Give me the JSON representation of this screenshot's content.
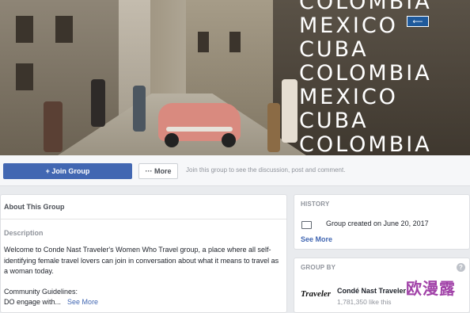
{
  "cover": {
    "overlay_words": [
      "COLOMBIA",
      "MEXICO",
      "CUBA",
      "COLOMBIA",
      "MEXICO",
      "CUBA",
      "COLOMBIA"
    ]
  },
  "actions": {
    "join_label": "+ Join Group",
    "more_label": "··· More",
    "join_note": "Join this group to see the discussion, post and comment."
  },
  "about": {
    "title": "About This Group",
    "description_heading": "Description",
    "description": "Welcome to Conde Nast Traveler's Women Who Travel group, a place where all self-identifying female travel lovers can join in conversation about what it means to travel as a woman today.",
    "guidelines_heading": "Community Guidelines:",
    "guidelines_preview": "DO engage with...",
    "see_more": "See More"
  },
  "history": {
    "title": "HISTORY",
    "created": "Group created on June 20, 2017",
    "see_more": "See More"
  },
  "group_by": {
    "title": "GROUP BY",
    "help": "?",
    "owner_name": "Condé Nast Traveler",
    "owner_likes": "1,781,350 like this",
    "logo_text": "Traveler"
  },
  "watermark": "欧漫露",
  "colors": {
    "accent": "#4267b2",
    "page_bg": "#e9ebee",
    "watermark": "#a142a8"
  }
}
